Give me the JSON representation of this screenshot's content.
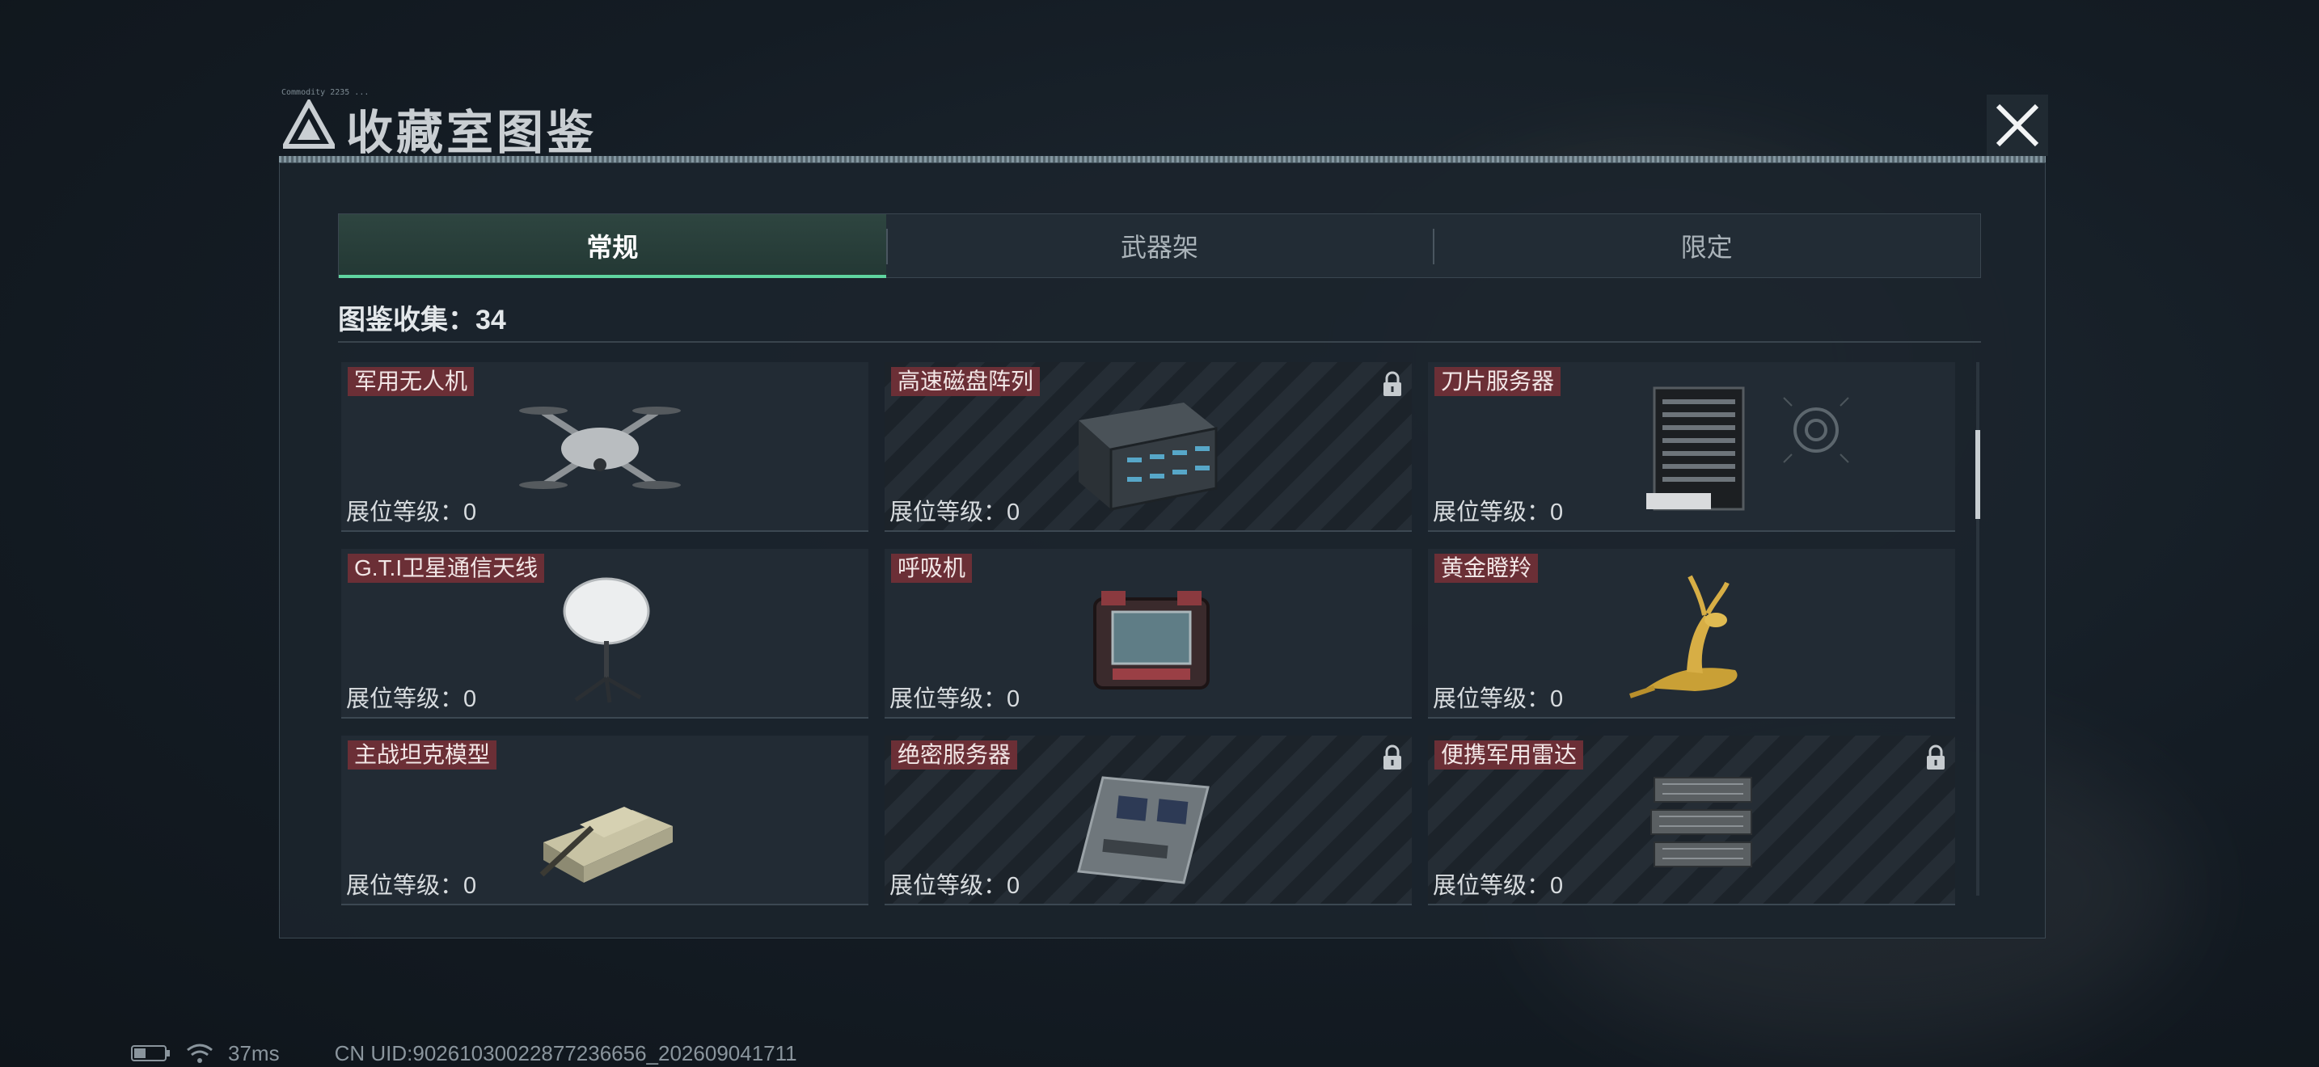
{
  "header": {
    "title": "收藏室图鉴",
    "tiny_tag": "Commodity 2235 ...",
    "close_icon": "close-icon"
  },
  "tabs": [
    {
      "label": "常规",
      "active": true
    },
    {
      "label": "武器架",
      "active": false
    },
    {
      "label": "限定",
      "active": false
    }
  ],
  "collection": {
    "label": "图鉴收集：34"
  },
  "items": [
    {
      "name": "军用无人机",
      "level": "展位等级：0",
      "locked": false,
      "icon": "drone-icon"
    },
    {
      "name": "高速磁盘阵列",
      "level": "展位等级：0",
      "locked": true,
      "icon": "disk-array-icon"
    },
    {
      "name": "刀片服务器",
      "level": "展位等级：0",
      "locked": false,
      "icon": "blade-server-icon"
    },
    {
      "name": "G.T.I卫星通信天线",
      "level": "展位等级：0",
      "locked": false,
      "icon": "satellite-antenna-icon"
    },
    {
      "name": "呼吸机",
      "level": "展位等级：0",
      "locked": false,
      "icon": "ventilator-icon"
    },
    {
      "name": "黄金瞪羚",
      "level": "展位等级：0",
      "locked": false,
      "icon": "golden-gazelle-icon"
    },
    {
      "name": "主战坦克模型",
      "level": "展位等级：0",
      "locked": false,
      "icon": "tank-model-icon"
    },
    {
      "name": "绝密服务器",
      "level": "展位等级：0",
      "locked": true,
      "icon": "server-board-icon"
    },
    {
      "name": "便携军用雷达",
      "level": "展位等级：0",
      "locked": true,
      "icon": "radar-icon"
    }
  ],
  "status": {
    "ping": "37ms",
    "uid": "CN UID:90261030022877236656_202609041711"
  },
  "colors": {
    "accent": "#5fd4a0",
    "name_tag": "#6b2f36"
  }
}
